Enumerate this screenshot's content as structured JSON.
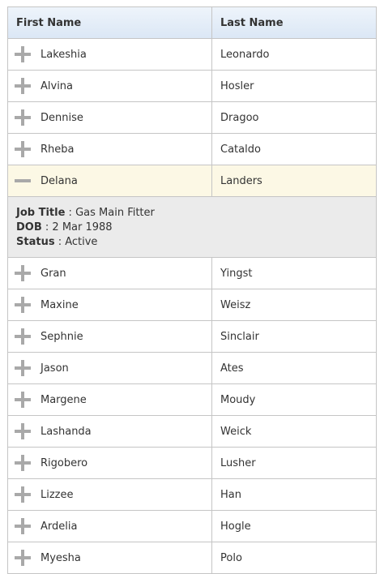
{
  "grid": {
    "columns": [
      "First Name",
      "Last Name"
    ],
    "rows": [
      {
        "first": "Lakeshia",
        "last": "Leonardo",
        "expanded": false
      },
      {
        "first": "Alvina",
        "last": "Hosler",
        "expanded": false
      },
      {
        "first": "Dennise",
        "last": "Dragoo",
        "expanded": false
      },
      {
        "first": "Rheba",
        "last": "Cataldo",
        "expanded": false
      },
      {
        "first": "Delana",
        "last": "Landers",
        "expanded": true
      },
      {
        "first": "Gran",
        "last": "Yingst",
        "expanded": false
      },
      {
        "first": "Maxine",
        "last": "Weisz",
        "expanded": false
      },
      {
        "first": "Sephnie",
        "last": "Sinclair",
        "expanded": false
      },
      {
        "first": "Jason",
        "last": "Ates",
        "expanded": false
      },
      {
        "first": "Margene",
        "last": "Moudy",
        "expanded": false
      },
      {
        "first": "Lashanda",
        "last": "Weick",
        "expanded": false
      },
      {
        "first": "Rigobero",
        "last": "Lusher",
        "expanded": false
      },
      {
        "first": "Lizzee",
        "last": "Han",
        "expanded": false
      },
      {
        "first": "Ardelia",
        "last": "Hogle",
        "expanded": false
      },
      {
        "first": "Myesha",
        "last": "Polo",
        "expanded": false
      }
    ],
    "detail": {
      "job_title_label": "Job Title",
      "job_title": "Gas Main Fitter",
      "dob_label": "DOB",
      "dob": "2 Mar 1988",
      "status_label": "Status",
      "status": "Active"
    }
  },
  "icons": {
    "collapsed": "plus-icon",
    "expanded": "minus-icon"
  },
  "colors": {
    "header_bg": "#dbe7f5",
    "selected_row_bg": "#fcf8e5",
    "detail_bg": "#ebebeb",
    "border": "#c5c5c5",
    "icon": "#a9a9a9"
  }
}
